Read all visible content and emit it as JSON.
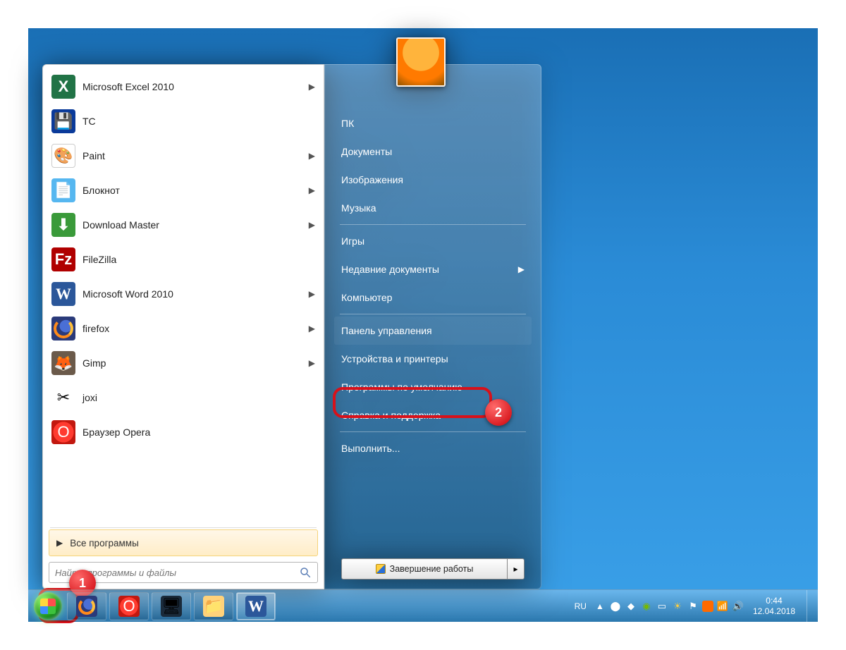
{
  "programs": [
    {
      "label": "Microsoft Excel 2010",
      "icon": "excel",
      "glyph": "X",
      "arrow": true
    },
    {
      "label": "TC",
      "icon": "save",
      "glyph": "💾",
      "arrow": false
    },
    {
      "label": "Paint",
      "icon": "paint",
      "glyph": "🎨",
      "arrow": true
    },
    {
      "label": "Блокнот",
      "icon": "note",
      "glyph": "📄",
      "arrow": true
    },
    {
      "label": "Download Master",
      "icon": "dm",
      "glyph": "⬇",
      "arrow": true
    },
    {
      "label": "FileZilla",
      "icon": "fz",
      "glyph": "Fz",
      "arrow": false
    },
    {
      "label": "Microsoft Word 2010",
      "icon": "word",
      "glyph": "W",
      "arrow": true
    },
    {
      "label": "firefox",
      "icon": "ff",
      "glyph": "",
      "arrow": true
    },
    {
      "label": "Gimp",
      "icon": "gimp",
      "glyph": "🦊",
      "arrow": true
    },
    {
      "label": "joxi",
      "icon": "joxi",
      "glyph": "✂",
      "arrow": false
    },
    {
      "label": "Браузер Opera",
      "icon": "opera",
      "glyph": "O",
      "arrow": false
    }
  ],
  "all_programs": "Все программы",
  "search_placeholder": "Найти программы и файлы",
  "right_menu": {
    "pc": "ПК",
    "documents": "Документы",
    "pictures": "Изображения",
    "music": "Музыка",
    "games": "Игры",
    "recent": "Недавние документы",
    "computer": "Компьютер",
    "control_panel": "Панель управления",
    "devices": "Устройства и принтеры",
    "defaults": "Программы по умолчанию",
    "help": "Справка и поддержка",
    "run": "Выполнить..."
  },
  "shutdown_label": "Завершение работы",
  "taskbar": {
    "lang": "RU",
    "time": "0:44",
    "date": "12.04.2018"
  },
  "badges": {
    "one": "1",
    "two": "2"
  }
}
